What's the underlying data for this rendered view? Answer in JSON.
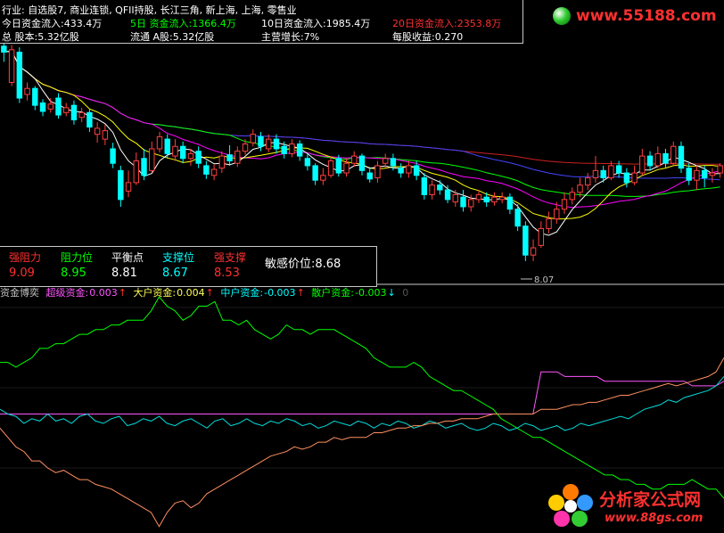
{
  "colors": {
    "up": "#ff4040",
    "down": "#00ffff",
    "ma5": "#ffffff",
    "ma10": "#ffff00",
    "ma20": "#ff00ff",
    "ma30": "#00ff00",
    "ma60": "#4444ff",
    "ma120": "#cc2020",
    "label": "#c0c0c0",
    "value": "#ffff55",
    "red": "#ff3030"
  },
  "info": {
    "industry": "行业: 自选股7, 商业连锁, QFII持股, 长江三角, 新上海, 上海, 零售业",
    "today_flow": "今日资金流入:433.4万",
    "flow5": "5日 资金流入:1366.4万",
    "flow10": "10日资金流入:1985.4万",
    "flow20": "20日资金流入:2353.8万",
    "total_shares": "总 股本:5.32亿股",
    "float_a": "流通 A股:5.32亿股",
    "growth": "主营增长:7%",
    "eps": "每股收益:0.270"
  },
  "levels": [
    {
      "label": "强阻力",
      "value": "9.09",
      "color": "#ff3030"
    },
    {
      "label": "阻力位",
      "value": "8.95",
      "color": "#00ff00"
    },
    {
      "label": "平衡点",
      "value": "8.81",
      "color": "#ffffff"
    },
    {
      "label": "支撑位",
      "value": "8.67",
      "color": "#00ffff"
    },
    {
      "label": "强支撑",
      "value": "8.53",
      "color": "#ff3030"
    }
  ],
  "sensitive": "敏感价位:8.68",
  "low_marker": "8.07",
  "flow": {
    "title": "资金博奕",
    "items": [
      {
        "label": "超级资金:",
        "value": "0.003",
        "arrow": "↑",
        "color": "#ff55ff"
      },
      {
        "label": "大户资金:",
        "value": "0.004",
        "arrow": "↑",
        "color": "#ffff55"
      },
      {
        "label": "中户资金:",
        "value": "-0.003",
        "arrow": "↑",
        "color": "#00ffff"
      },
      {
        "label": "散户资金:",
        "value": "-0.003",
        "arrow": "↓",
        "color": "#00ff00"
      }
    ],
    "tail": "0"
  },
  "watermarks": {
    "top": "www.55188.com",
    "bottom_cn": "分析家公式网",
    "bottom_url": "www.88gs.com"
  },
  "chart_data": [
    {
      "type": "candlestick",
      "ylim": [
        7.9,
        9.9
      ],
      "candles": [
        [
          9.85,
          9.8,
          9.88,
          9.72
        ],
        [
          9.55,
          9.82,
          9.86,
          9.52
        ],
        [
          9.8,
          9.42,
          9.84,
          9.38
        ],
        [
          9.45,
          9.5,
          9.55,
          9.4
        ],
        [
          9.5,
          9.36,
          9.52,
          9.32
        ],
        [
          9.38,
          9.31,
          9.41,
          9.27
        ],
        [
          9.33,
          9.37,
          9.42,
          9.3
        ],
        [
          9.42,
          9.28,
          9.46,
          9.25
        ],
        [
          9.3,
          9.34,
          9.38,
          9.27
        ],
        [
          9.36,
          9.24,
          9.4,
          9.2
        ],
        [
          9.26,
          9.3,
          9.34,
          9.22
        ],
        [
          9.3,
          9.18,
          9.33,
          9.14
        ],
        [
          9.12,
          9.17,
          9.22,
          9.05
        ],
        [
          9.08,
          9.15,
          9.2,
          9.03
        ],
        [
          9.0,
          8.88,
          9.05,
          8.84
        ],
        [
          8.82,
          8.58,
          8.86,
          8.52
        ],
        [
          8.65,
          8.72,
          8.82,
          8.6
        ],
        [
          8.72,
          8.9,
          8.97,
          8.7
        ],
        [
          8.92,
          8.78,
          9.0,
          8.74
        ],
        [
          8.82,
          9.0,
          9.06,
          8.8
        ],
        [
          9.0,
          9.1,
          9.14,
          8.97
        ],
        [
          9.08,
          8.96,
          9.12,
          8.92
        ],
        [
          8.94,
          9.02,
          9.08,
          8.9
        ],
        [
          9.02,
          8.92,
          9.06,
          8.88
        ],
        [
          8.92,
          8.96,
          9.0,
          8.86
        ],
        [
          8.98,
          8.88,
          9.02,
          8.84
        ],
        [
          8.86,
          8.79,
          8.9,
          8.75
        ],
        [
          8.78,
          8.83,
          8.87,
          8.74
        ],
        [
          8.84,
          8.94,
          8.98,
          8.8
        ],
        [
          8.95,
          8.9,
          9.03,
          8.86
        ],
        [
          8.88,
          8.98,
          9.02,
          8.85
        ],
        [
          8.98,
          9.04,
          9.08,
          8.95
        ],
        [
          9.05,
          9.12,
          9.16,
          9.02
        ],
        [
          9.1,
          9.02,
          9.14,
          8.98
        ],
        [
          9.0,
          9.08,
          9.12,
          8.97
        ],
        [
          9.08,
          9.0,
          9.12,
          8.96
        ],
        [
          9.02,
          8.96,
          9.06,
          8.92
        ],
        [
          8.96,
          9.04,
          9.08,
          8.93
        ],
        [
          9.04,
          8.94,
          9.07,
          8.9
        ],
        [
          8.92,
          8.86,
          8.96,
          8.82
        ],
        [
          8.86,
          8.74,
          8.88,
          8.7
        ],
        [
          8.74,
          8.78,
          8.84,
          8.7
        ],
        [
          8.78,
          8.9,
          8.94,
          8.76
        ],
        [
          8.92,
          8.8,
          8.95,
          8.77
        ],
        [
          8.8,
          8.88,
          8.92,
          8.77
        ],
        [
          8.88,
          8.94,
          8.98,
          8.85
        ],
        [
          8.94,
          8.82,
          8.96,
          8.78
        ],
        [
          8.8,
          8.75,
          8.85,
          8.72
        ],
        [
          8.76,
          8.86,
          8.9,
          8.72
        ],
        [
          8.88,
          8.92,
          8.96,
          8.84
        ],
        [
          8.92,
          8.86,
          8.96,
          8.82
        ],
        [
          8.84,
          8.8,
          8.88,
          8.76
        ],
        [
          8.8,
          8.86,
          8.9,
          8.76
        ],
        [
          8.86,
          8.78,
          8.9,
          8.74
        ],
        [
          8.76,
          8.62,
          8.8,
          8.58
        ],
        [
          8.62,
          8.7,
          8.74,
          8.58
        ],
        [
          8.7,
          8.66,
          8.74,
          8.62
        ],
        [
          8.66,
          8.58,
          8.7,
          8.55
        ],
        [
          8.56,
          8.62,
          8.66,
          8.52
        ],
        [
          8.6,
          8.52,
          8.66,
          8.48
        ],
        [
          8.52,
          8.58,
          8.62,
          8.48
        ],
        [
          8.58,
          8.62,
          8.66,
          8.55
        ],
        [
          8.6,
          8.56,
          8.64,
          8.52
        ],
        [
          8.56,
          8.6,
          8.64,
          8.53
        ],
        [
          8.58,
          8.6,
          8.64,
          8.55
        ],
        [
          8.6,
          8.5,
          8.63,
          8.46
        ],
        [
          8.5,
          8.36,
          8.54,
          8.32
        ],
        [
          8.36,
          8.12,
          8.4,
          8.07
        ],
        [
          8.12,
          8.18,
          8.25,
          8.07
        ],
        [
          8.2,
          8.34,
          8.4,
          8.18
        ],
        [
          8.34,
          8.42,
          8.48,
          8.3
        ],
        [
          8.42,
          8.5,
          8.56,
          8.38
        ],
        [
          8.5,
          8.58,
          8.64,
          8.46
        ],
        [
          8.58,
          8.64,
          8.68,
          8.54
        ],
        [
          8.64,
          8.7,
          8.76,
          8.6
        ],
        [
          8.7,
          8.76,
          8.8,
          8.66
        ],
        [
          8.76,
          8.82,
          8.94,
          8.72
        ],
        [
          8.82,
          8.76,
          8.86,
          8.72
        ],
        [
          8.76,
          8.86,
          8.9,
          8.74
        ],
        [
          8.86,
          8.8,
          8.9,
          8.76
        ],
        [
          8.8,
          8.72,
          8.84,
          8.68
        ],
        [
          8.72,
          8.8,
          8.86,
          8.7
        ],
        [
          8.8,
          8.94,
          9.0,
          8.78
        ],
        [
          8.94,
          8.86,
          8.98,
          8.82
        ],
        [
          8.86,
          8.96,
          9.02,
          8.84
        ],
        [
          8.96,
          8.88,
          9.0,
          8.84
        ],
        [
          8.88,
          9.02,
          9.06,
          8.86
        ],
        [
          9.02,
          8.84,
          9.06,
          8.8
        ],
        [
          8.84,
          8.74,
          8.88,
          8.7
        ],
        [
          8.74,
          8.82,
          8.86,
          8.66
        ],
        [
          8.82,
          8.76,
          8.86,
          8.68
        ],
        [
          8.78,
          8.8,
          8.84,
          8.72
        ],
        [
          8.8,
          8.86,
          8.88,
          8.76
        ]
      ]
    },
    {
      "type": "line",
      "series": [
        {
          "color": "#00ff00",
          "values": [
            0.72,
            0.72,
            0.7,
            0.72,
            0.74,
            0.78,
            0.78,
            0.8,
            0.8,
            0.82,
            0.84,
            0.84,
            0.86,
            0.86,
            0.88,
            0.88,
            0.9,
            0.9,
            0.9,
            0.94,
            1.0,
            0.96,
            0.94,
            0.9,
            0.92,
            0.96,
            0.96,
            0.98,
            0.9,
            0.9,
            0.88,
            0.9,
            0.86,
            0.84,
            0.82,
            0.84,
            0.88,
            0.86,
            0.86,
            0.84,
            0.86,
            0.86,
            0.86,
            0.84,
            0.82,
            0.8,
            0.78,
            0.74,
            0.72,
            0.7,
            0.7,
            0.7,
            0.72,
            0.7,
            0.66,
            0.64,
            0.62,
            0.6,
            0.6,
            0.58,
            0.56,
            0.54,
            0.52,
            0.48,
            0.46,
            0.44,
            0.42,
            0.4,
            0.4,
            0.38,
            0.36,
            0.34,
            0.32,
            0.3,
            0.28,
            0.26,
            0.24,
            0.24,
            0.22,
            0.22,
            0.2,
            0.2,
            0.18,
            0.18,
            0.2,
            0.2,
            0.2,
            0.22,
            0.2,
            0.18,
            0.18,
            0.14
          ]
        },
        {
          "color": "#ff55ff",
          "values": [
            0.5,
            0.5,
            0.5,
            0.5,
            0.5,
            0.5,
            0.5,
            0.5,
            0.5,
            0.5,
            0.5,
            0.5,
            0.5,
            0.5,
            0.5,
            0.5,
            0.5,
            0.5,
            0.5,
            0.5,
            0.5,
            0.5,
            0.5,
            0.5,
            0.5,
            0.5,
            0.5,
            0.5,
            0.5,
            0.5,
            0.5,
            0.5,
            0.5,
            0.5,
            0.5,
            0.5,
            0.5,
            0.5,
            0.5,
            0.5,
            0.5,
            0.5,
            0.5,
            0.5,
            0.5,
            0.5,
            0.5,
            0.5,
            0.5,
            0.5,
            0.5,
            0.5,
            0.5,
            0.5,
            0.5,
            0.5,
            0.5,
            0.5,
            0.5,
            0.5,
            0.5,
            0.5,
            0.5,
            0.5,
            0.5,
            0.5,
            0.5,
            0.5,
            0.68,
            0.68,
            0.68,
            0.66,
            0.66,
            0.66,
            0.66,
            0.66,
            0.64,
            0.64,
            0.64,
            0.64,
            0.64,
            0.64,
            0.64,
            0.64,
            0.64,
            0.64,
            0.64,
            0.62,
            0.62,
            0.62,
            0.62,
            0.64
          ]
        },
        {
          "color": "#00dddd",
          "values": [
            0.52,
            0.5,
            0.49,
            0.46,
            0.48,
            0.47,
            0.5,
            0.47,
            0.48,
            0.46,
            0.49,
            0.5,
            0.47,
            0.46,
            0.48,
            0.49,
            0.45,
            0.46,
            0.48,
            0.47,
            0.49,
            0.46,
            0.45,
            0.47,
            0.48,
            0.46,
            0.44,
            0.47,
            0.48,
            0.45,
            0.46,
            0.48,
            0.46,
            0.45,
            0.47,
            0.46,
            0.48,
            0.47,
            0.45,
            0.46,
            0.44,
            0.45,
            0.47,
            0.46,
            0.45,
            0.47,
            0.46,
            0.44,
            0.46,
            0.45,
            0.47,
            0.46,
            0.44,
            0.45,
            0.47,
            0.46,
            0.44,
            0.45,
            0.46,
            0.44,
            0.43,
            0.44,
            0.46,
            0.45,
            0.43,
            0.44,
            0.46,
            0.45,
            0.43,
            0.44,
            0.45,
            0.43,
            0.44,
            0.46,
            0.45,
            0.46,
            0.47,
            0.48,
            0.49,
            0.48,
            0.5,
            0.52,
            0.53,
            0.54,
            0.56,
            0.55,
            0.57,
            0.58,
            0.59,
            0.6,
            0.62,
            0.66
          ]
        },
        {
          "color": "#ff9060",
          "values": [
            0.44,
            0.4,
            0.36,
            0.34,
            0.3,
            0.3,
            0.27,
            0.25,
            0.26,
            0.24,
            0.22,
            0.22,
            0.2,
            0.19,
            0.18,
            0.16,
            0.14,
            0.12,
            0.1,
            0.08,
            0.02,
            0.08,
            0.12,
            0.13,
            0.1,
            0.12,
            0.16,
            0.18,
            0.2,
            0.22,
            0.24,
            0.26,
            0.28,
            0.3,
            0.32,
            0.33,
            0.34,
            0.36,
            0.35,
            0.36,
            0.38,
            0.38,
            0.4,
            0.39,
            0.4,
            0.4,
            0.4,
            0.42,
            0.42,
            0.43,
            0.44,
            0.44,
            0.45,
            0.45,
            0.46,
            0.46,
            0.47,
            0.47,
            0.48,
            0.48,
            0.48,
            0.49,
            0.5,
            0.5,
            0.5,
            0.5,
            0.5,
            0.5,
            0.52,
            0.52,
            0.52,
            0.53,
            0.54,
            0.54,
            0.55,
            0.55,
            0.56,
            0.57,
            0.58,
            0.58,
            0.59,
            0.6,
            0.61,
            0.62,
            0.63,
            0.62,
            0.63,
            0.64,
            0.65,
            0.66,
            0.68,
            0.74
          ]
        }
      ]
    }
  ]
}
